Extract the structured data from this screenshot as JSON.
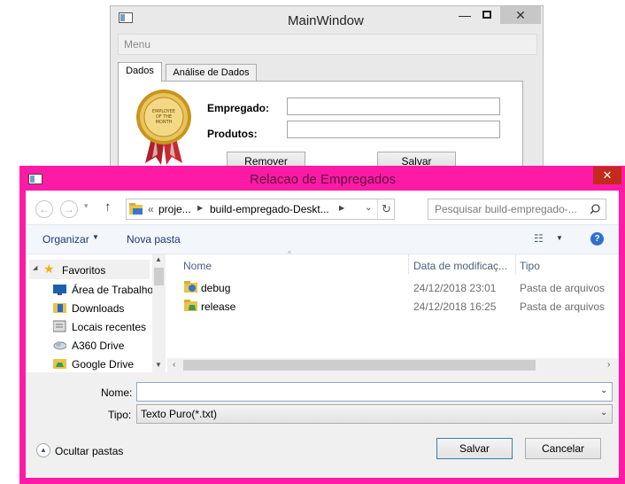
{
  "main_window": {
    "title": "MainWindow",
    "menu_label": "Menu",
    "tabs": [
      {
        "label": "Dados"
      },
      {
        "label": "Análise de Dados"
      }
    ],
    "form": {
      "employee_label": "Empregado:",
      "employee_value": "",
      "products_label": "Produtos:",
      "products_value": "",
      "remove_button": "Remover",
      "save_button": "Salvar"
    },
    "badge_text": "EMPLOYEE OF THE MONTH"
  },
  "dialog": {
    "title": "Relacao de Empregados",
    "title_bar_color": "#ff1aa6",
    "breadcrumb": [
      "proje...",
      "build-empregado-Deskt..."
    ],
    "breadcrumb_prefix": "«",
    "search_placeholder": "Pesquisar build-empregado-...",
    "toolbar": {
      "organize": "Organizar",
      "new_folder": "Nova pasta"
    },
    "nav_pane": {
      "favorites": "Favoritos",
      "items": [
        {
          "label": "Área de Trabalho",
          "icon": "desktop-icon"
        },
        {
          "label": "Downloads",
          "icon": "downloads-folder-icon"
        },
        {
          "label": "Locais recentes",
          "icon": "recent-places-icon"
        },
        {
          "label": "A360 Drive",
          "icon": "cloud-drive-icon"
        },
        {
          "label": "Google Drive",
          "icon": "google-drive-icon"
        }
      ]
    },
    "columns": {
      "name": "Nome",
      "modified": "Data de modificaç...",
      "type": "Tipo"
    },
    "files": [
      {
        "name": "debug",
        "modified": "24/12/2018 23:01",
        "type": "Pasta de arquivos"
      },
      {
        "name": "release",
        "modified": "24/12/2018 16:25",
        "type": "Pasta de arquivos"
      }
    ],
    "filename_label": "Nome:",
    "filename_value": "",
    "filetype_label": "Tipo:",
    "filetype_value": "Texto Puro(*.txt)",
    "hide_folders": "Ocultar pastas",
    "save_button": "Salvar",
    "cancel_button": "Cancelar"
  }
}
